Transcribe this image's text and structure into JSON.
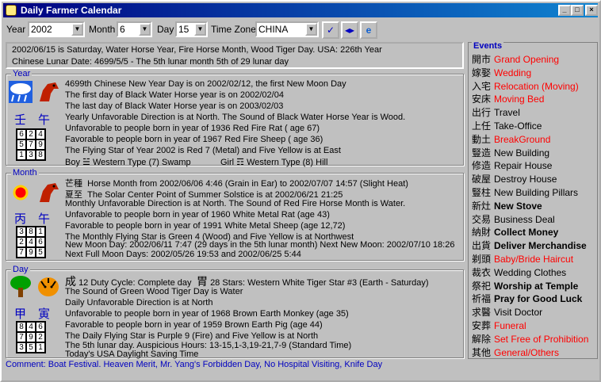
{
  "window": {
    "title": "Daily Farmer Calendar"
  },
  "toolbar": {
    "year_label": "Year",
    "year_value": "2002",
    "month_label": "Month",
    "month_value": "6",
    "day_label": "Day",
    "day_value": "15",
    "tz_label": "Time Zone",
    "tz_value": "CHINA"
  },
  "summary": {
    "line1": "2002/06/15 is Saturday,  Water Horse Year, Fire Horse Month, Wood Tiger Day.   USA: 226th Year",
    "line2": "Chinese Lunar Date: 4699/5/5 - The 5th lunar month 5th of 29 lunar day"
  },
  "year": {
    "title": "Year",
    "stem": "壬",
    "branch": "午",
    "grid": [
      "6",
      "2",
      "4",
      "5",
      "7",
      "9",
      "1",
      "3",
      "8"
    ],
    "lines": [
      "4699th Chinese New Year Day is on 2002/02/12, the first New Moon Day",
      "The first day of Black Water Horse year is on 2002/02/04",
      "The last day of Black Water Horse year is on 2003/02/03",
      "Yearly Unfavorable Direction is at North.      The Sound of Black Water Horse Year is Wood.",
      "Unfavorable to people born in year of 1936 Red Fire Rat ( age 67)",
      "Favorable to people born in year of 1967 Red Fire Sheep ( age 36)",
      "The Flying Star of Year 2002 is Red 7 (Metal) and Five Yellow is at East"
    ],
    "boy_label": "Boy",
    "boy_text": "Western Type (7) Swamp",
    "girl_label": "Girl",
    "girl_text": "Western Type (8) Hill"
  },
  "month": {
    "title": "Month",
    "stem": "丙",
    "branch": "午",
    "term1": "芒種",
    "term2": "夏至",
    "grid": [
      "3",
      "8",
      "1",
      "2",
      "4",
      "6",
      "7",
      "9",
      "5"
    ],
    "lines": [
      "Horse Month from 2002/06/06 4:46 (Grain in Ear) to 2002/07/07 14:57 (Slight Heat)",
      "The Solar Center Point of Summer Solstice is at 2002/06/21 21:25",
      "Monthly Unfavorable Direction is at North.      The Sound of Red Fire Horse Month is Water.",
      "Unfavorable to people born in year of 1960 White Metal Rat (age 43)",
      "Favorable to people born in year of 1991 White Metal Sheep (age 12,72)",
      "The Monthly Flying Star is Green 4 (Wood) and Five Yellow is at Northwest",
      "New Moon Day: 2002/06/11 7:47 (29 days in the 5th lunar month) Next New Moon: 2002/07/10 18:26",
      "Next Full Moon Days: 2002/05/26 19:53 and 2002/06/25 5:44"
    ]
  },
  "day": {
    "title": "Day",
    "stem": "甲",
    "branch": "寅",
    "c1": "成",
    "c2": "胃",
    "grid": [
      "8",
      "4",
      "6",
      "7",
      "9",
      "2",
      "3",
      "5",
      "1"
    ],
    "duty": "12 Duty Cycle: Complete day",
    "stars": "28 Stars: Western White Tiger Star #3 (Earth -  Saturday)",
    "lines": [
      "The Sound of Green Wood Tiger Day is Water",
      "Daily Unfavorable Direction is at North",
      "Unfavorable to people born in year of 1968 Brown Earth Monkey (age 35)",
      "Favorable to people born in year of 1959 Brown Earth Pig (age 44)",
      "The Daily Flying Star is Purple 9 (Fire) and Five Yellow is at North",
      "The 5th lunar day. Auspicious Hours: 13-15,1-3,19-21,7-9 (Standard Time)",
      "Today's USA Daylight Saving Time"
    ]
  },
  "events": {
    "title": "Events",
    "items": [
      {
        "zh": "開市",
        "en": "Grand Opening",
        "style": "red"
      },
      {
        "zh": "嫁娶",
        "en": "Wedding",
        "style": "red"
      },
      {
        "zh": "入宅",
        "en": "Relocation (Moving)",
        "style": "red"
      },
      {
        "zh": "安床",
        "en": "Moving Bed",
        "style": "red"
      },
      {
        "zh": "出行",
        "en": "Travel",
        "style": "normal"
      },
      {
        "zh": "上任",
        "en": "Take-Office",
        "style": "normal"
      },
      {
        "zh": "動土",
        "en": "BreakGround",
        "style": "red"
      },
      {
        "zh": "豎造",
        "en": "New Building",
        "style": "normal"
      },
      {
        "zh": "修造",
        "en": "Repair House",
        "style": "normal"
      },
      {
        "zh": "破屋",
        "en": "Destroy House",
        "style": "normal"
      },
      {
        "zh": "豎柱",
        "en": "New Building Pillars",
        "style": "normal"
      },
      {
        "zh": "新灶",
        "en": "New Stove",
        "style": "bold"
      },
      {
        "zh": "交易",
        "en": "Business Deal",
        "style": "normal"
      },
      {
        "zh": "納財",
        "en": "Collect Money",
        "style": "bold"
      },
      {
        "zh": "出貨",
        "en": "Deliver Merchandise",
        "style": "bold"
      },
      {
        "zh": "剃頭",
        "en": "Baby/Bride Haircut",
        "style": "red"
      },
      {
        "zh": "裁衣",
        "en": "Wedding Clothes",
        "style": "normal"
      },
      {
        "zh": "祭祀",
        "en": "Worship at Temple",
        "style": "bold"
      },
      {
        "zh": "祈福",
        "en": "Pray for Good Luck",
        "style": "bold"
      },
      {
        "zh": "求醫",
        "en": "Visit Doctor",
        "style": "normal"
      },
      {
        "zh": "安葬",
        "en": "Funeral",
        "style": "red"
      },
      {
        "zh": "解除",
        "en": "Set Free of Prohibition",
        "style": "red"
      },
      {
        "zh": "其他",
        "en": "General/Others",
        "style": "red"
      }
    ]
  },
  "comment": "Comment: Boat Festival. Heaven Merit, Mr. Yang's Forbidden Day, No Hospital Visiting, Knife Day",
  "colors": {
    "title_bar": "#000080",
    "accent": "#0000c0",
    "event_red": "#ff0000"
  }
}
